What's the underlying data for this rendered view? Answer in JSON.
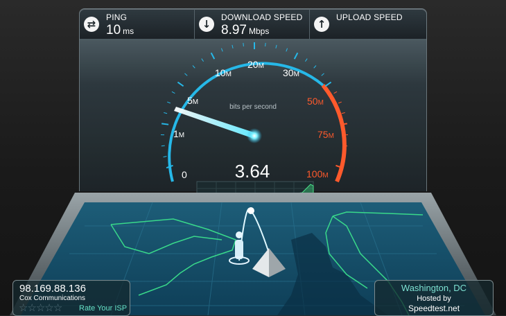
{
  "stats": {
    "ping": {
      "label": "PING",
      "value": "10",
      "unit": "ms",
      "icon": "ping-arrows-icon"
    },
    "download": {
      "label": "DOWNLOAD SPEED",
      "value": "8.97",
      "unit": "Mbps",
      "icon": "download-arrow-icon"
    },
    "upload": {
      "label": "UPLOAD SPEED",
      "value": "",
      "unit": "",
      "icon": "upload-arrow-icon"
    }
  },
  "gauge": {
    "caption": "bits per second",
    "reading": "3.64",
    "scale": [
      {
        "label": "0",
        "sub": ""
      },
      {
        "label": "1",
        "sub": "M"
      },
      {
        "label": "5",
        "sub": "M"
      },
      {
        "label": "10",
        "sub": "M"
      },
      {
        "label": "20",
        "sub": "M"
      },
      {
        "label": "30",
        "sub": "M"
      },
      {
        "label": "50",
        "sub": "M"
      },
      {
        "label": "75",
        "sub": "M"
      },
      {
        "label": "100",
        "sub": "M"
      }
    ],
    "colors": {
      "accent": "#26b8e8",
      "danger": "#ff5a2c",
      "needle": "#ffffff"
    }
  },
  "client": {
    "ip": "98.169.88.136",
    "isp": "Cox Communications",
    "rating_stars": 5,
    "rate_label": "Rate Your ISP"
  },
  "server": {
    "city": "Washington, DC",
    "hosted_label": "Hosted by",
    "sponsor": "Speedtest.net"
  }
}
